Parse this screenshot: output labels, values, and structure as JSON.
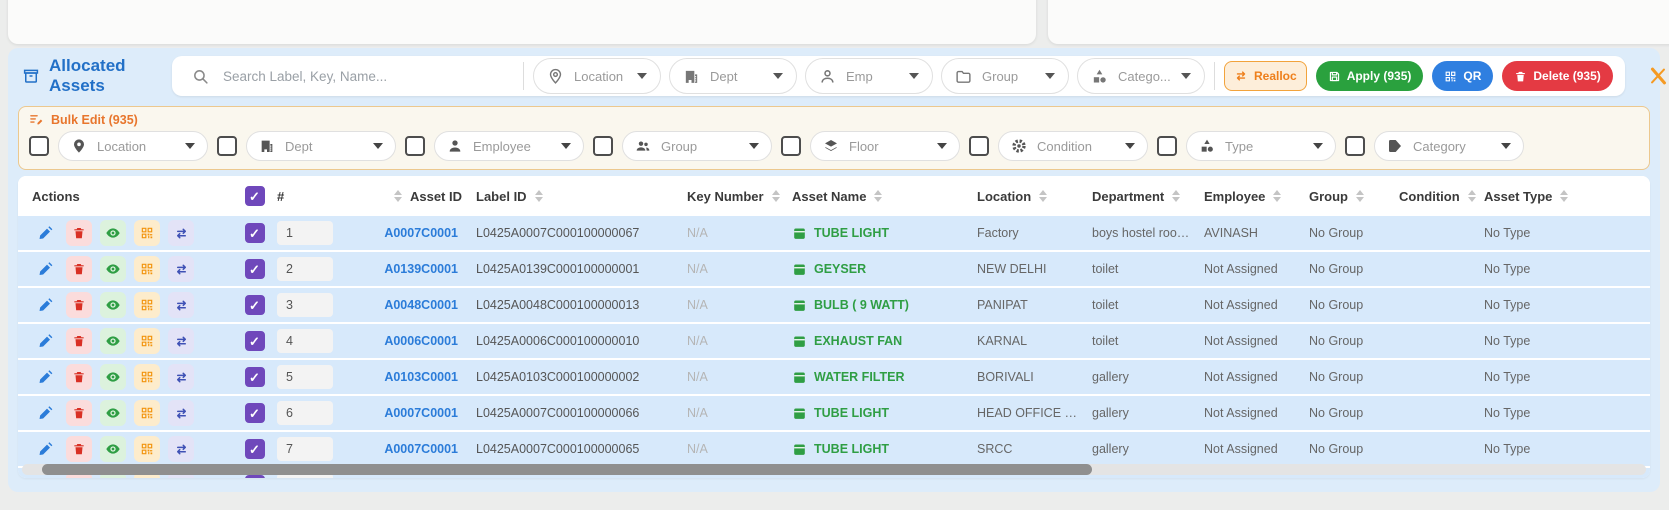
{
  "header": {
    "title": "Allocated Assets",
    "title_icon": "archive-box",
    "search_placeholder": "Search Label, Key, Name...",
    "filters": [
      {
        "label": "Location",
        "icon": "pin"
      },
      {
        "label": "Dept",
        "icon": "building"
      },
      {
        "label": "Emp",
        "icon": "person"
      },
      {
        "label": "Group",
        "icon": "folder"
      },
      {
        "label": "Catego...",
        "icon": "shapes"
      }
    ],
    "buttons": {
      "realloc": "Realloc",
      "apply": "Apply (935)",
      "qr": "QR",
      "delete": "Delete (935)"
    },
    "corner_icons": [
      "clear-filters-x",
      "refresh"
    ]
  },
  "bulk_edit": {
    "title": "Bulk Edit (935)",
    "fields": [
      {
        "label": "Location",
        "icon": "pin"
      },
      {
        "label": "Dept",
        "icon": "building"
      },
      {
        "label": "Employee",
        "icon": "person"
      },
      {
        "label": "Group",
        "icon": "people"
      },
      {
        "label": "Floor",
        "icon": "layers"
      },
      {
        "label": "Condition",
        "icon": "gear"
      },
      {
        "label": "Type",
        "icon": "shapes"
      },
      {
        "label": "Category",
        "icon": "tag"
      }
    ]
  },
  "table": {
    "columns": [
      "Actions",
      "#",
      "Asset ID",
      "Label ID",
      "Key Number",
      "Asset Name",
      "Location",
      "Department",
      "Employee",
      "Group",
      "Condition",
      "Asset Type"
    ],
    "row_action_icons": [
      "edit-pencil",
      "delete-trash",
      "view-eye",
      "qr-code",
      "reallocate-arrows"
    ],
    "rows": [
      {
        "num": "1",
        "asset_id": "A0007C0001",
        "label_id": "L0425A0007C000100000067",
        "key_number": "N/A",
        "asset_name": "TUBE LIGHT",
        "location": "Factory",
        "department": "boys hostel room ...",
        "employee": "AVINASH",
        "group": "No Group",
        "condition": "",
        "asset_type": "No Type"
      },
      {
        "num": "2",
        "asset_id": "A0139C0001",
        "label_id": "L0425A0139C000100000001",
        "key_number": "N/A",
        "asset_name": "GEYSER",
        "location": "NEW DELHI",
        "department": "toilet",
        "employee": "Not Assigned",
        "group": "No Group",
        "condition": "",
        "asset_type": "No Type"
      },
      {
        "num": "3",
        "asset_id": "A0048C0001",
        "label_id": "L0425A0048C000100000013",
        "key_number": "N/A",
        "asset_name": "BULB ( 9 WATT)",
        "location": "PANIPAT",
        "department": "toilet",
        "employee": "Not Assigned",
        "group": "No Group",
        "condition": "",
        "asset_type": "No Type"
      },
      {
        "num": "4",
        "asset_id": "A0006C0001",
        "label_id": "L0425A0006C000100000010",
        "key_number": "N/A",
        "asset_name": "EXHAUST FAN",
        "location": "KARNAL",
        "department": "toilet",
        "employee": "Not Assigned",
        "group": "No Group",
        "condition": "",
        "asset_type": "No Type"
      },
      {
        "num": "5",
        "asset_id": "A0103C0001",
        "label_id": "L0425A0103C000100000002",
        "key_number": "N/A",
        "asset_name": "WATER FILTER",
        "location": "BORIVALI",
        "department": "gallery",
        "employee": "Not Assigned",
        "group": "No Group",
        "condition": "",
        "asset_type": "No Type"
      },
      {
        "num": "6",
        "asset_id": "A0007C0001",
        "label_id": "L0425A0007C000100000066",
        "key_number": "N/A",
        "asset_name": "TUBE LIGHT",
        "location": "HEAD OFFICE MU...",
        "department": "gallery",
        "employee": "Not Assigned",
        "group": "No Group",
        "condition": "",
        "asset_type": "No Type"
      },
      {
        "num": "7",
        "asset_id": "A0007C0001",
        "label_id": "L0425A0007C000100000065",
        "key_number": "N/A",
        "asset_name": "TUBE LIGHT",
        "location": "SRCC",
        "department": "gallery",
        "employee": "Not Assigned",
        "group": "No Group",
        "condition": "",
        "asset_type": "No Type"
      }
    ]
  },
  "colors": {
    "accent_blue": "#2b7cd9",
    "accent_green": "#2f9e44",
    "accent_orange": "#ee7f1b",
    "accent_red": "#e43a43",
    "checkbox_purple": "#6f48bb",
    "row_blue": "#d7e9fb",
    "panel_blue": "#ddecfa"
  }
}
